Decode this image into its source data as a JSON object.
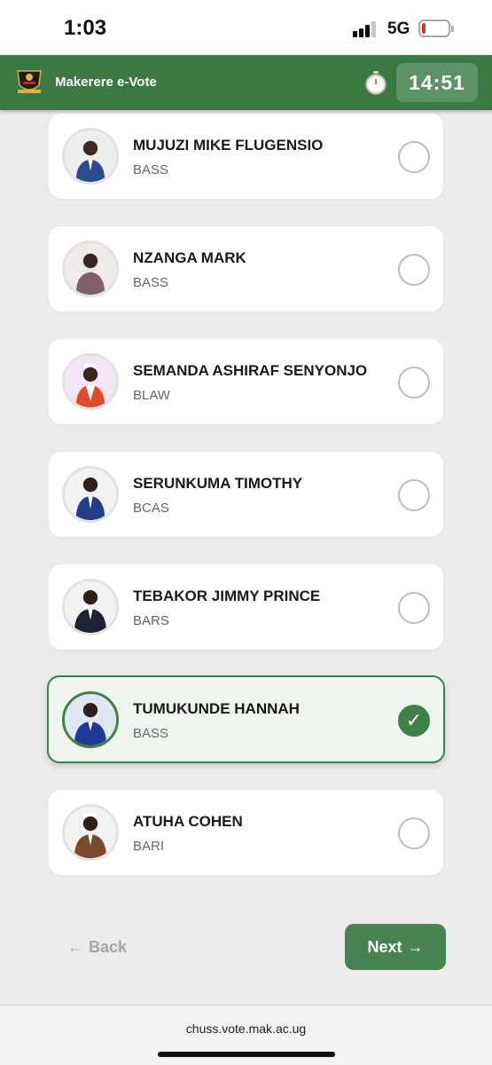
{
  "status_bar": {
    "time": "1:03",
    "network": "5G",
    "battery_level": 0.15
  },
  "header": {
    "app_title": "Makerere e-Vote",
    "timer": "14:51",
    "logo_icon": "university-crest-icon",
    "timer_icon": "stopwatch-icon"
  },
  "candidates": [
    {
      "name": "MUJUZI MIKE FLUGENSIO",
      "faculty": "BASS",
      "selected": false
    },
    {
      "name": "NZANGA MARK",
      "faculty": "BASS",
      "selected": false
    },
    {
      "name": "SEMANDA ASHIRAF SENYONJO",
      "faculty": "BLAW",
      "selected": false
    },
    {
      "name": "SERUNKUMA TIMOTHY",
      "faculty": "BCAS",
      "selected": false
    },
    {
      "name": "TEBAKOR JIMMY PRINCE",
      "faculty": "BARS",
      "selected": false
    },
    {
      "name": "TUMUKUNDE HANNAH",
      "faculty": "BASS",
      "selected": true
    },
    {
      "name": "ATUHA COHEN",
      "faculty": "BARI",
      "selected": false
    }
  ],
  "nav": {
    "back_label": "Back",
    "next_label": "Next",
    "back_arrow": "←",
    "next_arrow": "→"
  },
  "browser": {
    "url": "chuss.vote.mak.ac.ug"
  },
  "colors": {
    "brand_green": "#3a7a42",
    "selected_bg": "#eef5ef",
    "next_button": "#4a8352"
  }
}
